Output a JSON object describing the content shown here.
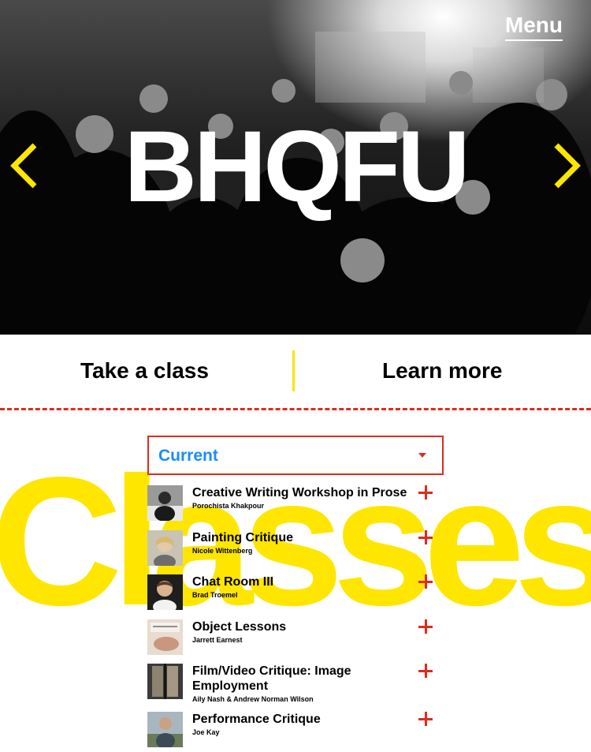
{
  "hero": {
    "title": "BHQFU",
    "menu_label": "Menu",
    "prev_icon": "chevron-left-icon",
    "next_icon": "chevron-right-icon"
  },
  "nav": {
    "take_class": "Take a class",
    "learn_more": "Learn more"
  },
  "classes": {
    "background_word": "Classes",
    "filter_value": "Current",
    "items": [
      {
        "title": "Creative Writing Workshop in Prose",
        "teacher": "Porochista Khakpour"
      },
      {
        "title": "Painting Critique",
        "teacher": "Nicole Wittenberg"
      },
      {
        "title": "Chat Room III",
        "teacher": "Brad Troemel"
      },
      {
        "title": "Object Lessons",
        "teacher": "Jarrett Earnest"
      },
      {
        "title": "Film/Video Critique: Image Employment",
        "teacher": "Aily Nash & Andrew Norman Wilson"
      },
      {
        "title": "Performance Critique",
        "teacher": "Joe Kay"
      }
    ]
  },
  "colors": {
    "accent_yellow": "#ffe600",
    "accent_red": "#e02b1c",
    "link_blue": "#1a8cff"
  }
}
